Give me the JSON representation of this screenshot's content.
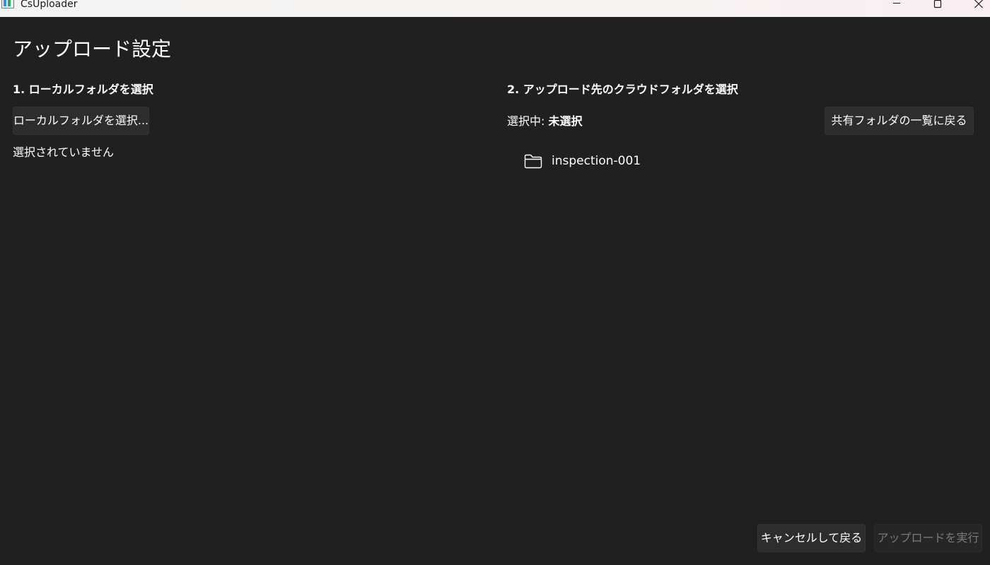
{
  "window": {
    "title": "CsUploader"
  },
  "page": {
    "title": "アップロード設定"
  },
  "local": {
    "heading": "1. ローカルフォルダを選択",
    "select_button_label": "ローカルフォルダを選択...",
    "status": "選択されていません"
  },
  "cloud": {
    "heading": "2. アップロード先のクラウドフォルダを選択",
    "selected_label": "選択中: ",
    "selected_value": "未選択",
    "back_button_label": "共有フォルダの一覧に戻る",
    "folders": [
      {
        "name": "inspection-001",
        "icon": "folder-icon"
      }
    ]
  },
  "footer": {
    "cancel_label": "キャンセルして戻る",
    "run_label": "アップロードを実行",
    "run_enabled": false
  },
  "colors": {
    "background": "#202020",
    "button": "#2d2d2d",
    "text": "#ffffff",
    "disabled_text": "#7a7a7a"
  }
}
